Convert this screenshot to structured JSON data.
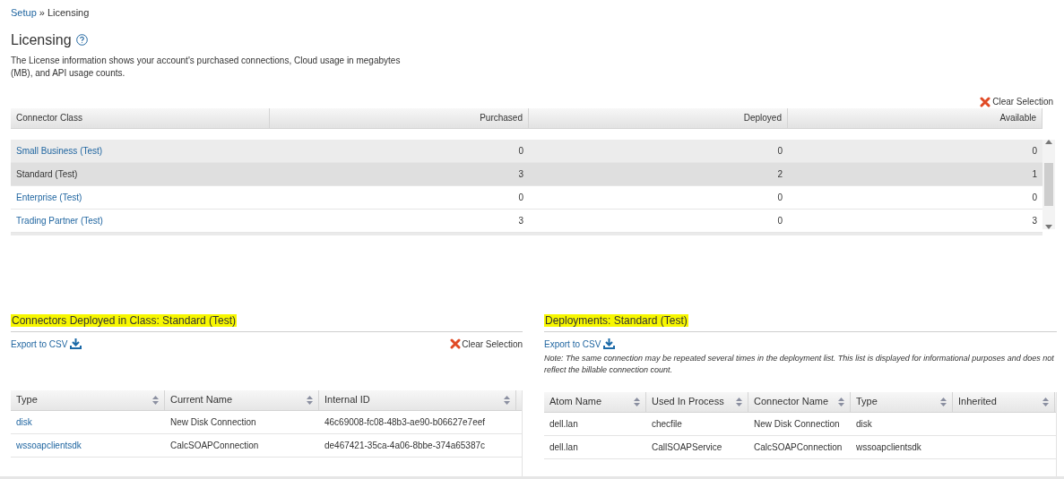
{
  "breadcrumb": {
    "link": "Setup",
    "separator": "»",
    "current": "Licensing"
  },
  "title": "Licensing",
  "description": "The License information shows your account's purchased connections, Cloud usage in megabytes (MB), and API usage counts.",
  "license_table": {
    "clear_selection": "Clear Selection",
    "columns": [
      "Connector Class",
      "Purchased",
      "Deployed",
      "Available"
    ],
    "rows": [
      {
        "cells": [
          "Small Business (Test)",
          "0",
          "0",
          "0"
        ],
        "selected": false,
        "hovered": true
      },
      {
        "cells": [
          "Standard (Test)",
          "3",
          "2",
          "1"
        ],
        "selected": true,
        "hovered": false
      },
      {
        "cells": [
          "Enterprise (Test)",
          "0",
          "0",
          "0"
        ],
        "selected": false,
        "hovered": false
      },
      {
        "cells": [
          "Trading Partner (Test)",
          "3",
          "0",
          "3"
        ],
        "selected": false,
        "hovered": false
      }
    ]
  },
  "connectors_panel": {
    "heading": "Connectors Deployed in Class: Standard (Test)",
    "highlighted": true,
    "export": "Export to CSV",
    "clear_selection": "Clear Selection",
    "columns": [
      "Type",
      "Current Name",
      "Internal ID"
    ],
    "rows": [
      {
        "cells": [
          "disk",
          "New Disk Connection",
          "46c69008-fc08-48b3-ae90-b06627e7eef"
        ]
      },
      {
        "cells": [
          "wssoapclientsdk",
          "CalcSOAPConnection",
          "de467421-35ca-4a06-8bbe-374a65387c"
        ]
      }
    ]
  },
  "deployments_panel": {
    "heading": "Deployments: Standard (Test)",
    "highlighted": true,
    "export": "Export to CSV",
    "note": "Note: The same connection may be repeated several times in the deployment list. This list is displayed for informational purposes and does not reflect the billable connection count.",
    "columns": [
      "Atom Name",
      "Used In Process",
      "Connector Name",
      "Type",
      "Inherited"
    ],
    "rows": [
      {
        "cells": [
          "dell.lan",
          "checfile",
          "New Disk Connection",
          "disk"
        ]
      },
      {
        "cells": [
          "dell.lan",
          "CallSOAPService",
          "CalcSOAPConnection",
          "wssoapclientsdk"
        ]
      }
    ]
  }
}
